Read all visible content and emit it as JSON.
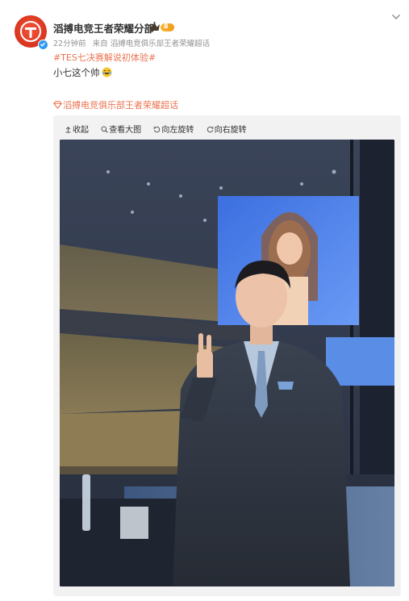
{
  "post": {
    "author_name": "滔搏电竞王者荣耀分部",
    "level_badge": "8",
    "time": "22分钟前",
    "source_prefix": "来自",
    "source_client": "滔搏电竞俱乐部王者荣耀超话",
    "topic": "#TES七决赛解说初体验#",
    "text": "小七这个帅",
    "emoji_name": "laughing-face-emoji",
    "supertopic_link": "滔搏电竞俱乐部王者荣耀超话"
  },
  "toolbar": {
    "collapse_label": "收起",
    "view_large_label": "查看大图",
    "rotate_left_label": "向左旋转",
    "rotate_right_label": "向右旋转"
  },
  "photo": {
    "description_icon": "photo-of-man-in-suit-at-esports-arena"
  },
  "colors": {
    "accent": "#eb7350",
    "text": "#333333",
    "meta": "#939393",
    "media_bg": "#f2f2f2",
    "verified": "#2f9bf0"
  }
}
